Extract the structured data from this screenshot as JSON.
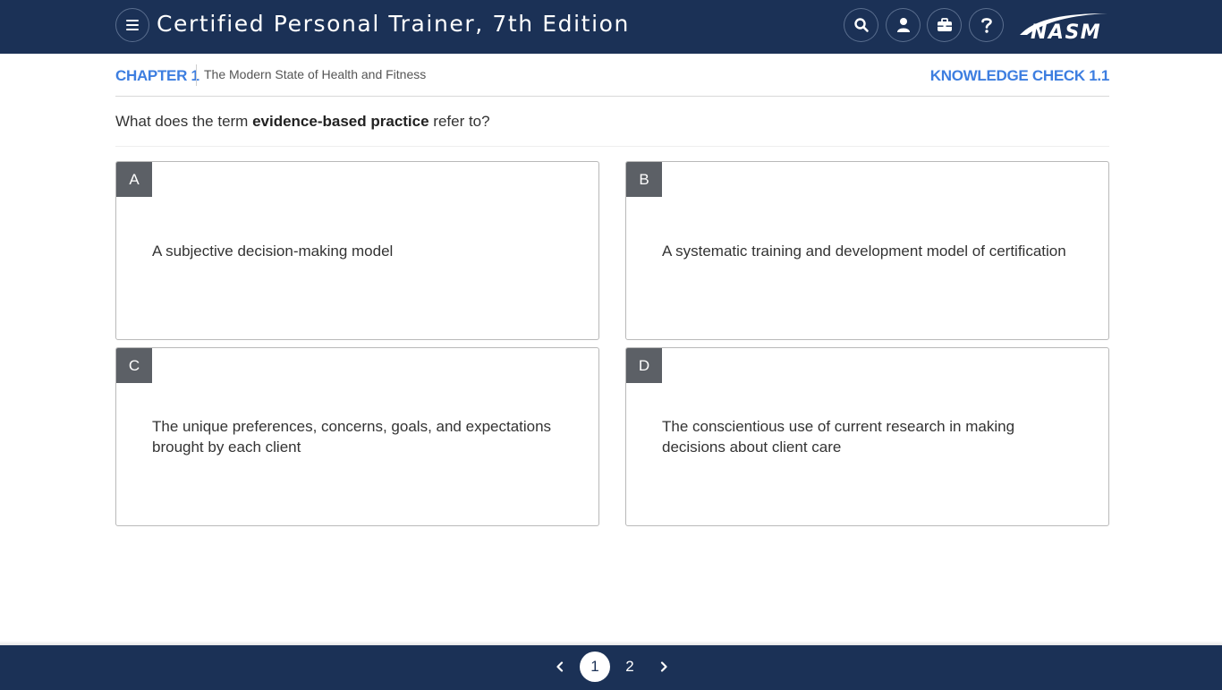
{
  "header": {
    "app_title": "Certified Personal Trainer, 7th Edition",
    "logo_text": "NASM",
    "icons": [
      "menu-icon",
      "search-icon",
      "user-icon",
      "toolbox-icon",
      "help-icon"
    ]
  },
  "chapter": {
    "label": "CHAPTER 1",
    "subtitle": "The Modern State of Health and Fitness",
    "knowledge_check": "KNOWLEDGE CHECK 1.1"
  },
  "question": {
    "prefix": "What does the term ",
    "term": "evidence-based practice",
    "suffix": " refer to?"
  },
  "options": [
    {
      "letter": "A",
      "text": "A subjective decision-making model"
    },
    {
      "letter": "B",
      "text": "A systematic training and development model of certification"
    },
    {
      "letter": "C",
      "text": "The unique preferences, concerns, goals, and expectations brought by each client"
    },
    {
      "letter": "D",
      "text": "The conscientious use of current research in making decisions about client care"
    }
  ],
  "pagination": {
    "pages": [
      "1",
      "2"
    ],
    "current": "1"
  },
  "colors": {
    "navbar": "#1b3156",
    "accent": "#3d7ee0",
    "option_letter_bg": "#5c6066"
  }
}
